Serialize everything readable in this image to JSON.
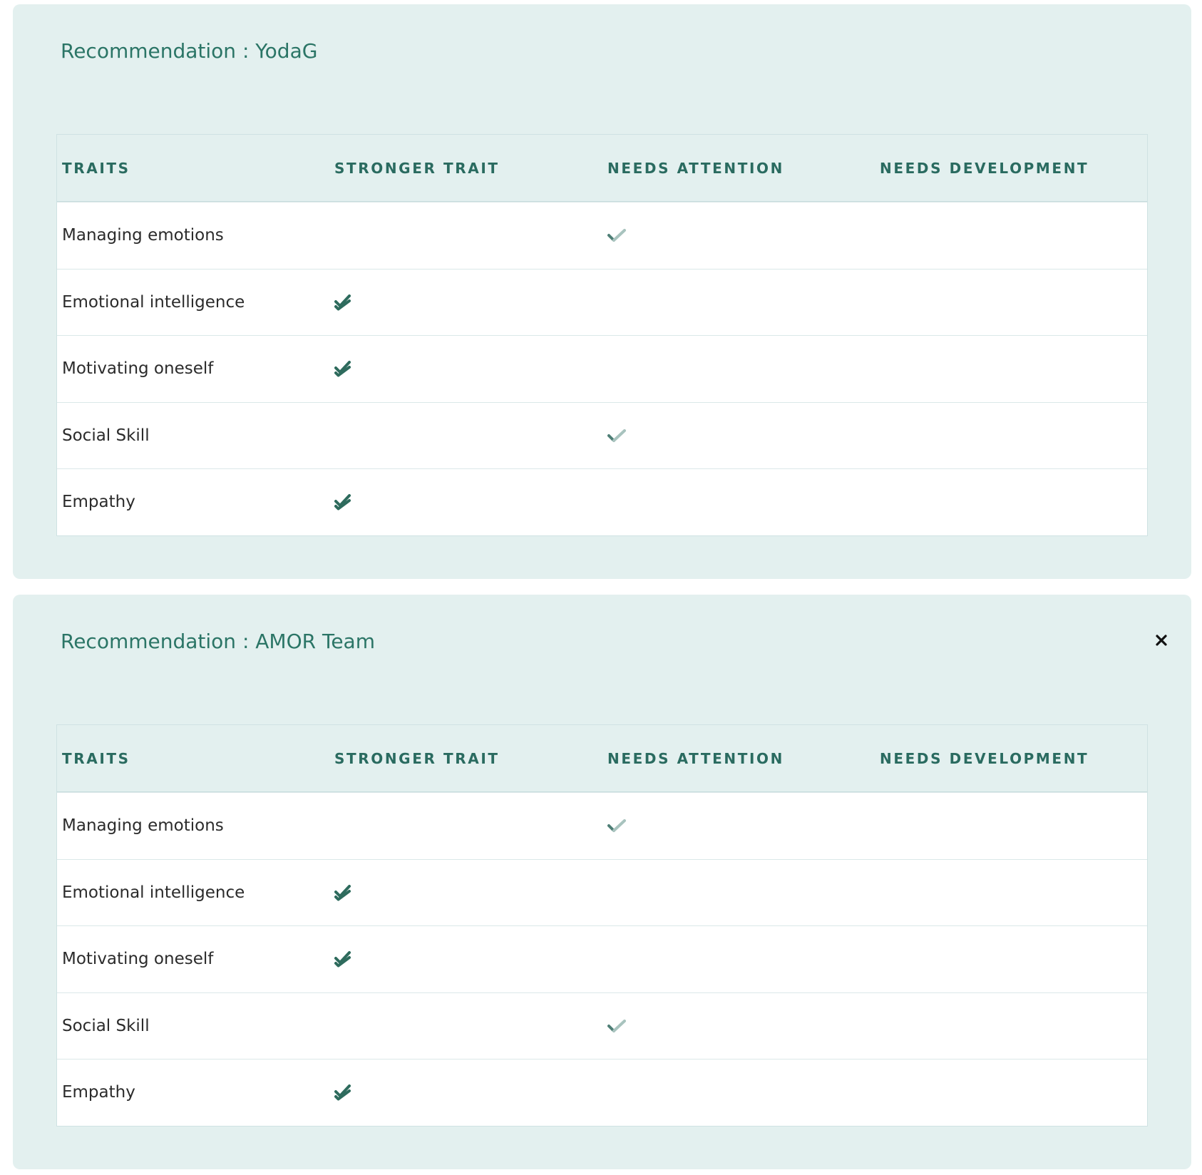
{
  "panels": [
    {
      "title": "Recommendation : YodaG",
      "has_close": false,
      "columns": [
        "TRAITS",
        "STRONGER TRAIT",
        "NEEDS ATTENTION",
        "NEEDS DEVELOPMENT"
      ],
      "rows": [
        {
          "trait": "Managing emotions",
          "level": "needs_attention"
        },
        {
          "trait": "Emotional intelligence",
          "level": "stronger_trait"
        },
        {
          "trait": "Motivating oneself",
          "level": "stronger_trait"
        },
        {
          "trait": "Social Skill",
          "level": "needs_attention"
        },
        {
          "trait": "Empathy",
          "level": "stronger_trait"
        }
      ]
    },
    {
      "title": "Recommendation : AMOR Team",
      "has_close": true,
      "columns": [
        "TRAITS",
        "STRONGER TRAIT",
        "NEEDS ATTENTION",
        "NEEDS DEVELOPMENT"
      ],
      "rows": [
        {
          "trait": "Managing emotions",
          "level": "needs_attention"
        },
        {
          "trait": "Emotional intelligence",
          "level": "stronger_trait"
        },
        {
          "trait": "Motivating oneself",
          "level": "stronger_trait"
        },
        {
          "trait": "Social Skill",
          "level": "needs_attention"
        },
        {
          "trait": "Empathy",
          "level": "stronger_trait"
        }
      ]
    }
  ],
  "icons": {
    "stronger_trait": "double-check-icon",
    "needs_attention": "check-icon",
    "close": "close-icon"
  },
  "colors": {
    "panel_bg": "#e3f0ef",
    "title": "#2b7566",
    "header_text": "#2a6b60",
    "double_check": "#2e6b5d",
    "single_check_dark": "#4f7f76",
    "single_check_light": "#a8c3be"
  }
}
